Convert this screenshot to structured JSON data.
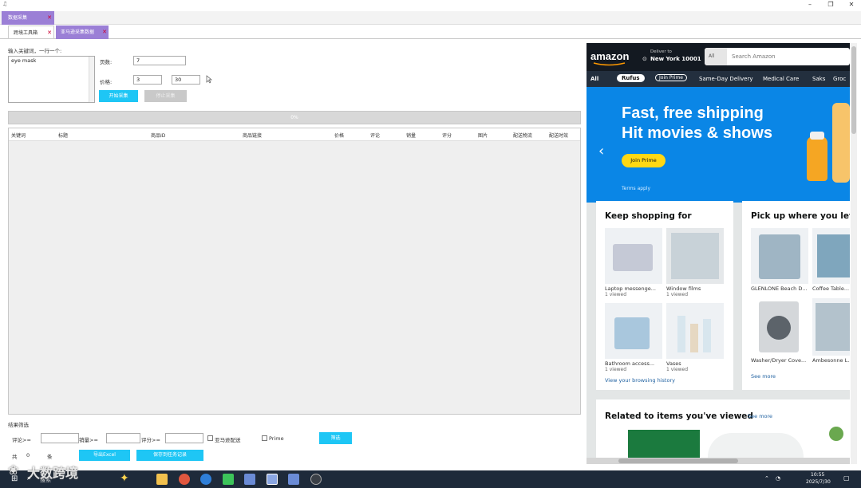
{
  "window": {
    "title_glyph": "♫",
    "controls": [
      "–",
      "❐",
      "✕"
    ]
  },
  "tabs_top": [
    {
      "label": "数据采集",
      "close": "✕"
    }
  ],
  "tabs_second": [
    {
      "label": "跨境工具箱",
      "close": "✕"
    },
    {
      "label": "亚马逊采集数据",
      "close": "✕"
    }
  ],
  "form": {
    "keyword_label": "输入关键词，一行一个:",
    "keyword_value": "eye mask",
    "pages_label": "页数:",
    "pages_value": "7",
    "price_label": "价格:",
    "price_min": "3",
    "price_max": "30",
    "start_button": "开始采集",
    "stop_button": "停止采集"
  },
  "progress_text": "0%",
  "grid": {
    "columns": [
      "关键词",
      "标题",
      "商品ID",
      "商品链接",
      "价格",
      "评论",
      "销量",
      "评分",
      "图片",
      "配送物流",
      "配送时效"
    ]
  },
  "filter": {
    "section_label": "结果筛选",
    "review_label": "评论>=",
    "sales_label": "销量>=",
    "rating_label": "评分>=",
    "check1": "亚马逊配送",
    "check2": "Prime",
    "filter_button": "筛选",
    "count_prefix": "共",
    "count_value": "0",
    "count_suffix": "条",
    "export_button": "导出Excel",
    "save_button": "保存到任务记录"
  },
  "browser": {
    "logo": "amazon",
    "deliver_line1": "Deliver to",
    "deliver_line2": "New York 10001",
    "search_category": "All",
    "search_placeholder": "Search Amazon",
    "nav": [
      "All",
      "Rufus",
      "Join Prime",
      "Same-Day Delivery",
      "Medical Care",
      "Saks",
      "Groc"
    ],
    "hero_line1": "Fast, free shipping",
    "hero_line2": "Hit movies & shows",
    "hero_button": "Join Prime",
    "hero_terms": "Terms apply",
    "card1": {
      "title": "Keep shopping for",
      "items": [
        {
          "name": "Laptop messenge...",
          "sub": "1 viewed"
        },
        {
          "name": "Window films",
          "sub": "1 viewed"
        },
        {
          "name": "Bathroom access...",
          "sub": "1 viewed"
        },
        {
          "name": "Vases",
          "sub": "1 viewed"
        }
      ],
      "footer": "View your browsing history"
    },
    "card2": {
      "title": "Pick up where you left",
      "items": [
        {
          "name": "GLENLONE Beach D..."
        },
        {
          "name": "Coffee Table..."
        },
        {
          "name": "Washer/Dryer Cove..."
        },
        {
          "name": "Ambesonne L..."
        }
      ],
      "footer": "See more"
    },
    "card3": {
      "title": "Related to items you've viewed",
      "link": "See more"
    }
  },
  "taskbar": {
    "search_label": "搜索",
    "time": "10:55",
    "date": "2025/7/30",
    "watermark": "大数跨境"
  },
  "colors": {
    "accent_blue": "#1ec6f5",
    "tab_purple": "#9b7fd6",
    "amazon_dark": "#131921",
    "amazon_nav": "#232f3e",
    "hero_blue": "#0a86e6",
    "prime_yellow": "#ffd814"
  }
}
